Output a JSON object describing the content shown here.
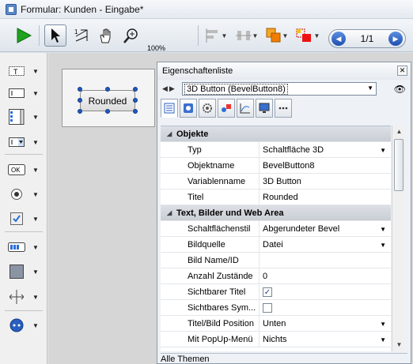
{
  "window": {
    "title": "Formular: Kunden - Eingabe*"
  },
  "toolbar": {
    "zoom_percent": "100%",
    "record_counter": "1/1",
    "icons": [
      "run-icon",
      "arrow-pointer-icon",
      "tab-order-icon",
      "hand-icon",
      "zoom-icon",
      "zoom-level-icon",
      "align-icon",
      "distribute-icon",
      "layer-icon",
      "color-icon",
      "prev-record-icon",
      "next-record-icon"
    ]
  },
  "left_tools": [
    {
      "icon": "static-text-tool-icon"
    },
    {
      "icon": "input-field-tool-icon"
    },
    {
      "icon": "list-box-tool-icon"
    },
    {
      "icon": "dropdown-tool-icon"
    },
    {
      "icon": "button-tool-icon",
      "text": "OK"
    },
    {
      "icon": "radio-button-tool-icon"
    },
    {
      "icon": "checkbox-tool-icon"
    },
    {
      "icon": "progress-tool-icon"
    },
    {
      "icon": "rectangle-tool-icon"
    },
    {
      "icon": "splitter-tool-icon"
    },
    {
      "icon": "plugin-tool-icon"
    }
  ],
  "canvas": {
    "button_label": "Rounded"
  },
  "properties": {
    "title": "Eigenschaftenliste",
    "selected_object": "3D Button (BevelButton8)",
    "tabs": [
      "objects-tab-icon",
      "appearance-tab-icon",
      "actions-tab-icon",
      "objects-methods-tab-icon",
      "graph-tab-icon",
      "display-tab-icon",
      "more-tab-icon"
    ],
    "rows": [
      {
        "type": "section",
        "label": "Objekte"
      },
      {
        "type": "prop",
        "name": "Typ",
        "value": "Schaltfläche 3D",
        "dropdown": true
      },
      {
        "type": "prop",
        "name": "Objektname",
        "value": "BevelButton8"
      },
      {
        "type": "prop",
        "name": "Variablenname",
        "value": "3D Button"
      },
      {
        "type": "prop",
        "name": "Titel",
        "value": "Rounded"
      },
      {
        "type": "section",
        "label": "Text, Bilder und Web Area"
      },
      {
        "type": "prop",
        "name": "Schaltflächenstil",
        "value": "Abgerundeter Bevel",
        "dropdown": true
      },
      {
        "type": "prop",
        "name": "Bildquelle",
        "value": "Datei",
        "dropdown": true
      },
      {
        "type": "prop",
        "name": "Bild Name/ID",
        "value": ""
      },
      {
        "type": "prop",
        "name": "Anzahl Zustände",
        "value": "0"
      },
      {
        "type": "prop",
        "name": "Sichtbarer Titel",
        "checkbox": true,
        "checked": true
      },
      {
        "type": "prop",
        "name": "Sichtbares Sym...",
        "checkbox": true,
        "checked": false
      },
      {
        "type": "prop",
        "name": "Titel/Bild Position",
        "value": "Unten",
        "dropdown": true
      },
      {
        "type": "prop",
        "name": "Mit PopUp-Menü",
        "value": "Nichts",
        "dropdown": true
      }
    ],
    "footer": "Alle Themen"
  },
  "colors": {
    "accent": "#2159c0",
    "run_green": "#1fa31f",
    "section_bg": "#cfd4da"
  }
}
